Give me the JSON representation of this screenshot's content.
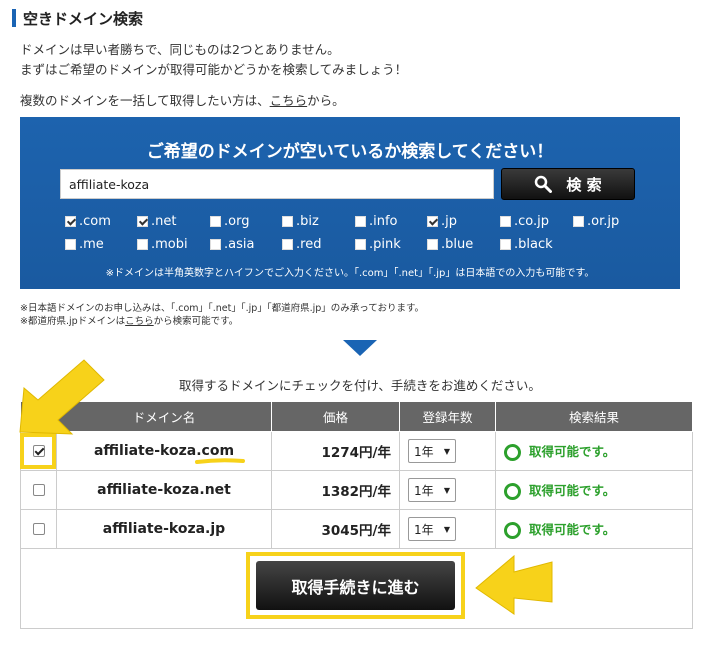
{
  "section": {
    "title": "空きドメイン検索"
  },
  "intro": {
    "line1": "ドメインは早い者勝ちで、同じものは2つとありません。",
    "line2": "まずはご希望のドメインが取得可能かどうかを検索してみましょう！",
    "line3_prefix": "複数のドメインを一括して取得したい方は、",
    "line3_link": "こちら",
    "line3_suffix": "から。"
  },
  "search": {
    "heading": "ご希望のドメインが空いているか検索してください！",
    "input_value": "affiliate-koza",
    "button_label": "検 索",
    "note": "※ドメインは半角英数字とハイフンでご入力ください。「.com」「.net」「.jp」は日本語での入力も可能です。",
    "tlds": [
      {
        "label": ".com",
        "checked": true
      },
      {
        "label": ".net",
        "checked": true
      },
      {
        "label": ".org",
        "checked": false
      },
      {
        "label": ".biz",
        "checked": false
      },
      {
        "label": ".info",
        "checked": false
      },
      {
        "label": ".jp",
        "checked": true
      },
      {
        "label": ".co.jp",
        "checked": false
      },
      {
        "label": ".or.jp",
        "checked": false
      },
      {
        "label": ".me",
        "checked": false
      },
      {
        "label": ".mobi",
        "checked": false
      },
      {
        "label": ".asia",
        "checked": false
      },
      {
        "label": ".red",
        "checked": false
      },
      {
        "label": ".pink",
        "checked": false
      },
      {
        "label": ".blue",
        "checked": false
      },
      {
        "label": ".black",
        "checked": false
      }
    ]
  },
  "notes": {
    "line1": "※日本語ドメインのお申し込みは、「.com」「.net」「.jp」「都道府県.jp」のみ承っております。",
    "line2_prefix": "※都道府県.jpドメインは",
    "line2_link": "こちら",
    "line2_suffix": "から検索可能です。"
  },
  "instruction": "取得するドメインにチェックを付け、手続きをお進めください。",
  "table": {
    "headers": [
      "",
      "ドメイン名",
      "価格",
      "登録年数",
      "検索結果"
    ],
    "rows": [
      {
        "checked": true,
        "domain": "affiliate-koza.com",
        "price": "1274円/年",
        "years": "1年",
        "status": "取得可能です。"
      },
      {
        "checked": false,
        "domain": "affiliate-koza.net",
        "price": "1382円/年",
        "years": "1年",
        "status": "取得可能です。"
      },
      {
        "checked": false,
        "domain": "affiliate-koza.jp",
        "price": "3045円/年",
        "years": "1年",
        "status": "取得可能です。"
      }
    ]
  },
  "proceed_button": "取得手続きに進む",
  "colors": {
    "panel_blue": "#1c5fa7",
    "accent_yellow": "#f7d21a",
    "status_green": "#2ca02c",
    "table_header": "#666666"
  }
}
